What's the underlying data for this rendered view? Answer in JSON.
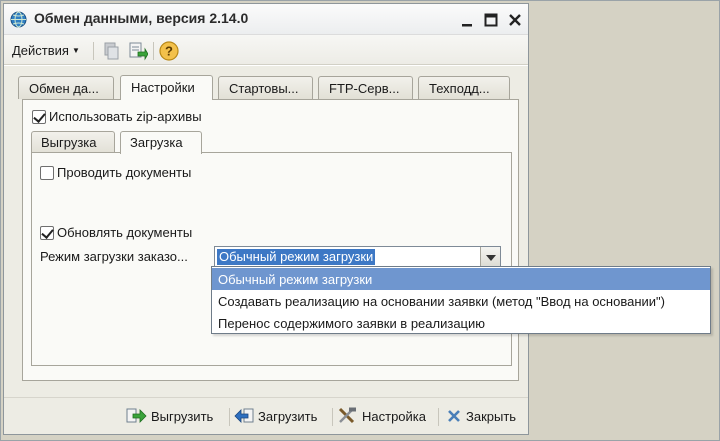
{
  "window": {
    "title": "Обмен данными, версия 2.14.0"
  },
  "toolbar": {
    "actions_label": "Действия"
  },
  "tabs": [
    {
      "label": "Обмен да..."
    },
    {
      "label": "Настройки"
    },
    {
      "label": "Стартовы..."
    },
    {
      "label": "FTP-Серв..."
    },
    {
      "label": "Техподд..."
    }
  ],
  "settings": {
    "use_zip_label": "Использовать zip-архивы",
    "use_zip_checked": true
  },
  "inner_tabs": [
    {
      "label": "Выгрузка"
    },
    {
      "label": "Загрузка"
    }
  ],
  "load": {
    "post_documents_label": "Проводить документы",
    "post_documents_checked": false,
    "update_documents_label": "Обновлять документы",
    "update_documents_checked": true,
    "order_mode_label": "Режим загрузки заказо...",
    "order_mode_value": "Обычный режим загрузки",
    "order_mode_options": [
      "Обычный режим загрузки",
      "Создавать реализацию на основании заявки (метод \"Ввод на основании\")",
      "Перенос содержимого заявки в реализацию"
    ]
  },
  "bottom": {
    "export_label": "Выгрузить",
    "import_label": "Загрузить",
    "setup_label": "Настройка",
    "close_label": "Закрыть"
  },
  "colors": {
    "selection": "#3d78c5",
    "dropdown_highlight": "#6f96cf",
    "panel_bg": "#edece4",
    "desktop_bg": "#d5d2c4"
  }
}
